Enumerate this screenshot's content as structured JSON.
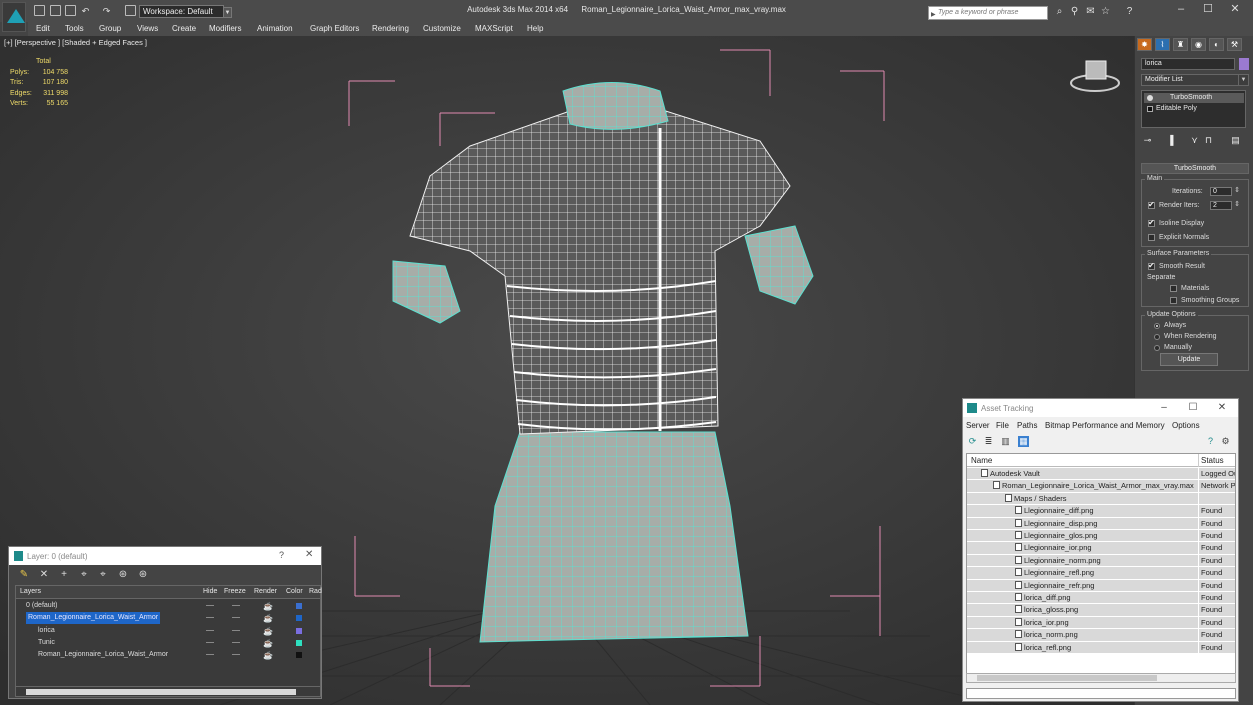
{
  "app": {
    "title": "Autodesk 3ds Max  2014 x64",
    "file": "Roman_Legionnaire_Lorica_Waist_Armor_max_vray.max",
    "workspace": "Workspace: Default",
    "search_placeholder": "Type a keyword or phrase"
  },
  "menu": [
    "Edit",
    "Tools",
    "Group",
    "Views",
    "Create",
    "Modifiers",
    "Animation",
    "Graph Editors",
    "Rendering",
    "Customize",
    "MAXScript",
    "Help"
  ],
  "viewport": {
    "label": "[+] [Perspective ] [Shaded + Edged Faces ]",
    "stats": {
      "header": "Total",
      "rows": [
        {
          "label": "Polys:",
          "value": "104 758"
        },
        {
          "label": "Tris:",
          "value": "107 180"
        },
        {
          "label": "Edges:",
          "value": "311 998"
        },
        {
          "label": "Verts:",
          "value": "55 165"
        }
      ]
    }
  },
  "command_panel": {
    "object_name": "lorica",
    "object_color": "#9b7ad0",
    "modifier_list": "Modifier List",
    "stack": [
      "TurboSmooth",
      "Editable Poly"
    ],
    "rollout_title": "TurboSmooth",
    "main_label": "Main",
    "iterations_label": "Iterations:",
    "iterations_value": "0",
    "render_iters_label": "Render Iters:",
    "render_iters_value": "2",
    "isoline_label": "Isoline Display",
    "explicit_label": "Explicit Normals",
    "surface_label": "Surface Parameters",
    "smooth_label": "Smooth Result",
    "separate_label": "Separate",
    "materials_label": "Materials",
    "smoothing_label": "Smoothing Groups",
    "update_label": "Update Options",
    "always_label": "Always",
    "when_label": "When Rendering",
    "manually_label": "Manually",
    "update_button": "Update"
  },
  "asset_tracking": {
    "title": "Asset Tracking",
    "menu": [
      "Server",
      "File",
      "Paths",
      "Bitmap Performance and Memory",
      "Options"
    ],
    "col_name": "Name",
    "col_status": "Status",
    "rows": [
      {
        "name": "Autodesk Vault",
        "status": "Logged Ou",
        "indent": 14
      },
      {
        "name": "Roman_Legionnaire_Lorica_Waist_Armor_max_vray.max",
        "status": "Network P",
        "indent": 26
      },
      {
        "name": "Maps / Shaders",
        "status": "",
        "indent": 38
      },
      {
        "name": "Llegionnaire_diff.png",
        "status": "Found",
        "indent": 48
      },
      {
        "name": "Llegionnaire_disp.png",
        "status": "Found",
        "indent": 48
      },
      {
        "name": "Llegionnaire_glos.png",
        "status": "Found",
        "indent": 48
      },
      {
        "name": "Llegionnaire_ior.png",
        "status": "Found",
        "indent": 48
      },
      {
        "name": "Llegionnaire_norm.png",
        "status": "Found",
        "indent": 48
      },
      {
        "name": "Llegionnaire_refl.png",
        "status": "Found",
        "indent": 48
      },
      {
        "name": "Llegionnaire_refr.png",
        "status": "Found",
        "indent": 48
      },
      {
        "name": "lorica_diff.png",
        "status": "Found",
        "indent": 48
      },
      {
        "name": "lorica_gloss.png",
        "status": "Found",
        "indent": 48
      },
      {
        "name": "lorica_ior.png",
        "status": "Found",
        "indent": 48
      },
      {
        "name": "lorica_norm.png",
        "status": "Found",
        "indent": 48
      },
      {
        "name": "lorica_refl.png",
        "status": "Found",
        "indent": 48
      }
    ]
  },
  "layer_dialog": {
    "title": "Layer: 0 (default)",
    "help": "?",
    "columns": [
      "Layers",
      "Hide",
      "Freeze",
      "Render",
      "Color",
      "Rad"
    ],
    "rows": [
      {
        "name": "0 (default)",
        "indent": 10,
        "color": "#3a6fd0",
        "selected": false
      },
      {
        "name": "Roman_Legionnaire_Lorica_Waist_Armor",
        "indent": 10,
        "color": "#1e66c8",
        "selected": true
      },
      {
        "name": "lorica",
        "indent": 22,
        "color": "#7a6ee0",
        "selected": false
      },
      {
        "name": "Tunic",
        "indent": 22,
        "color": "#2ee0c0",
        "selected": false
      },
      {
        "name": "Roman_Legionnaire_Lorica_Waist_Armor",
        "indent": 22,
        "color": "#111111",
        "selected": false
      }
    ]
  },
  "colors": {
    "wire_cyan": "#5ee0d0",
    "bbox_pink": "#e08ab0",
    "stats_yellow": "#f0dc6a"
  }
}
